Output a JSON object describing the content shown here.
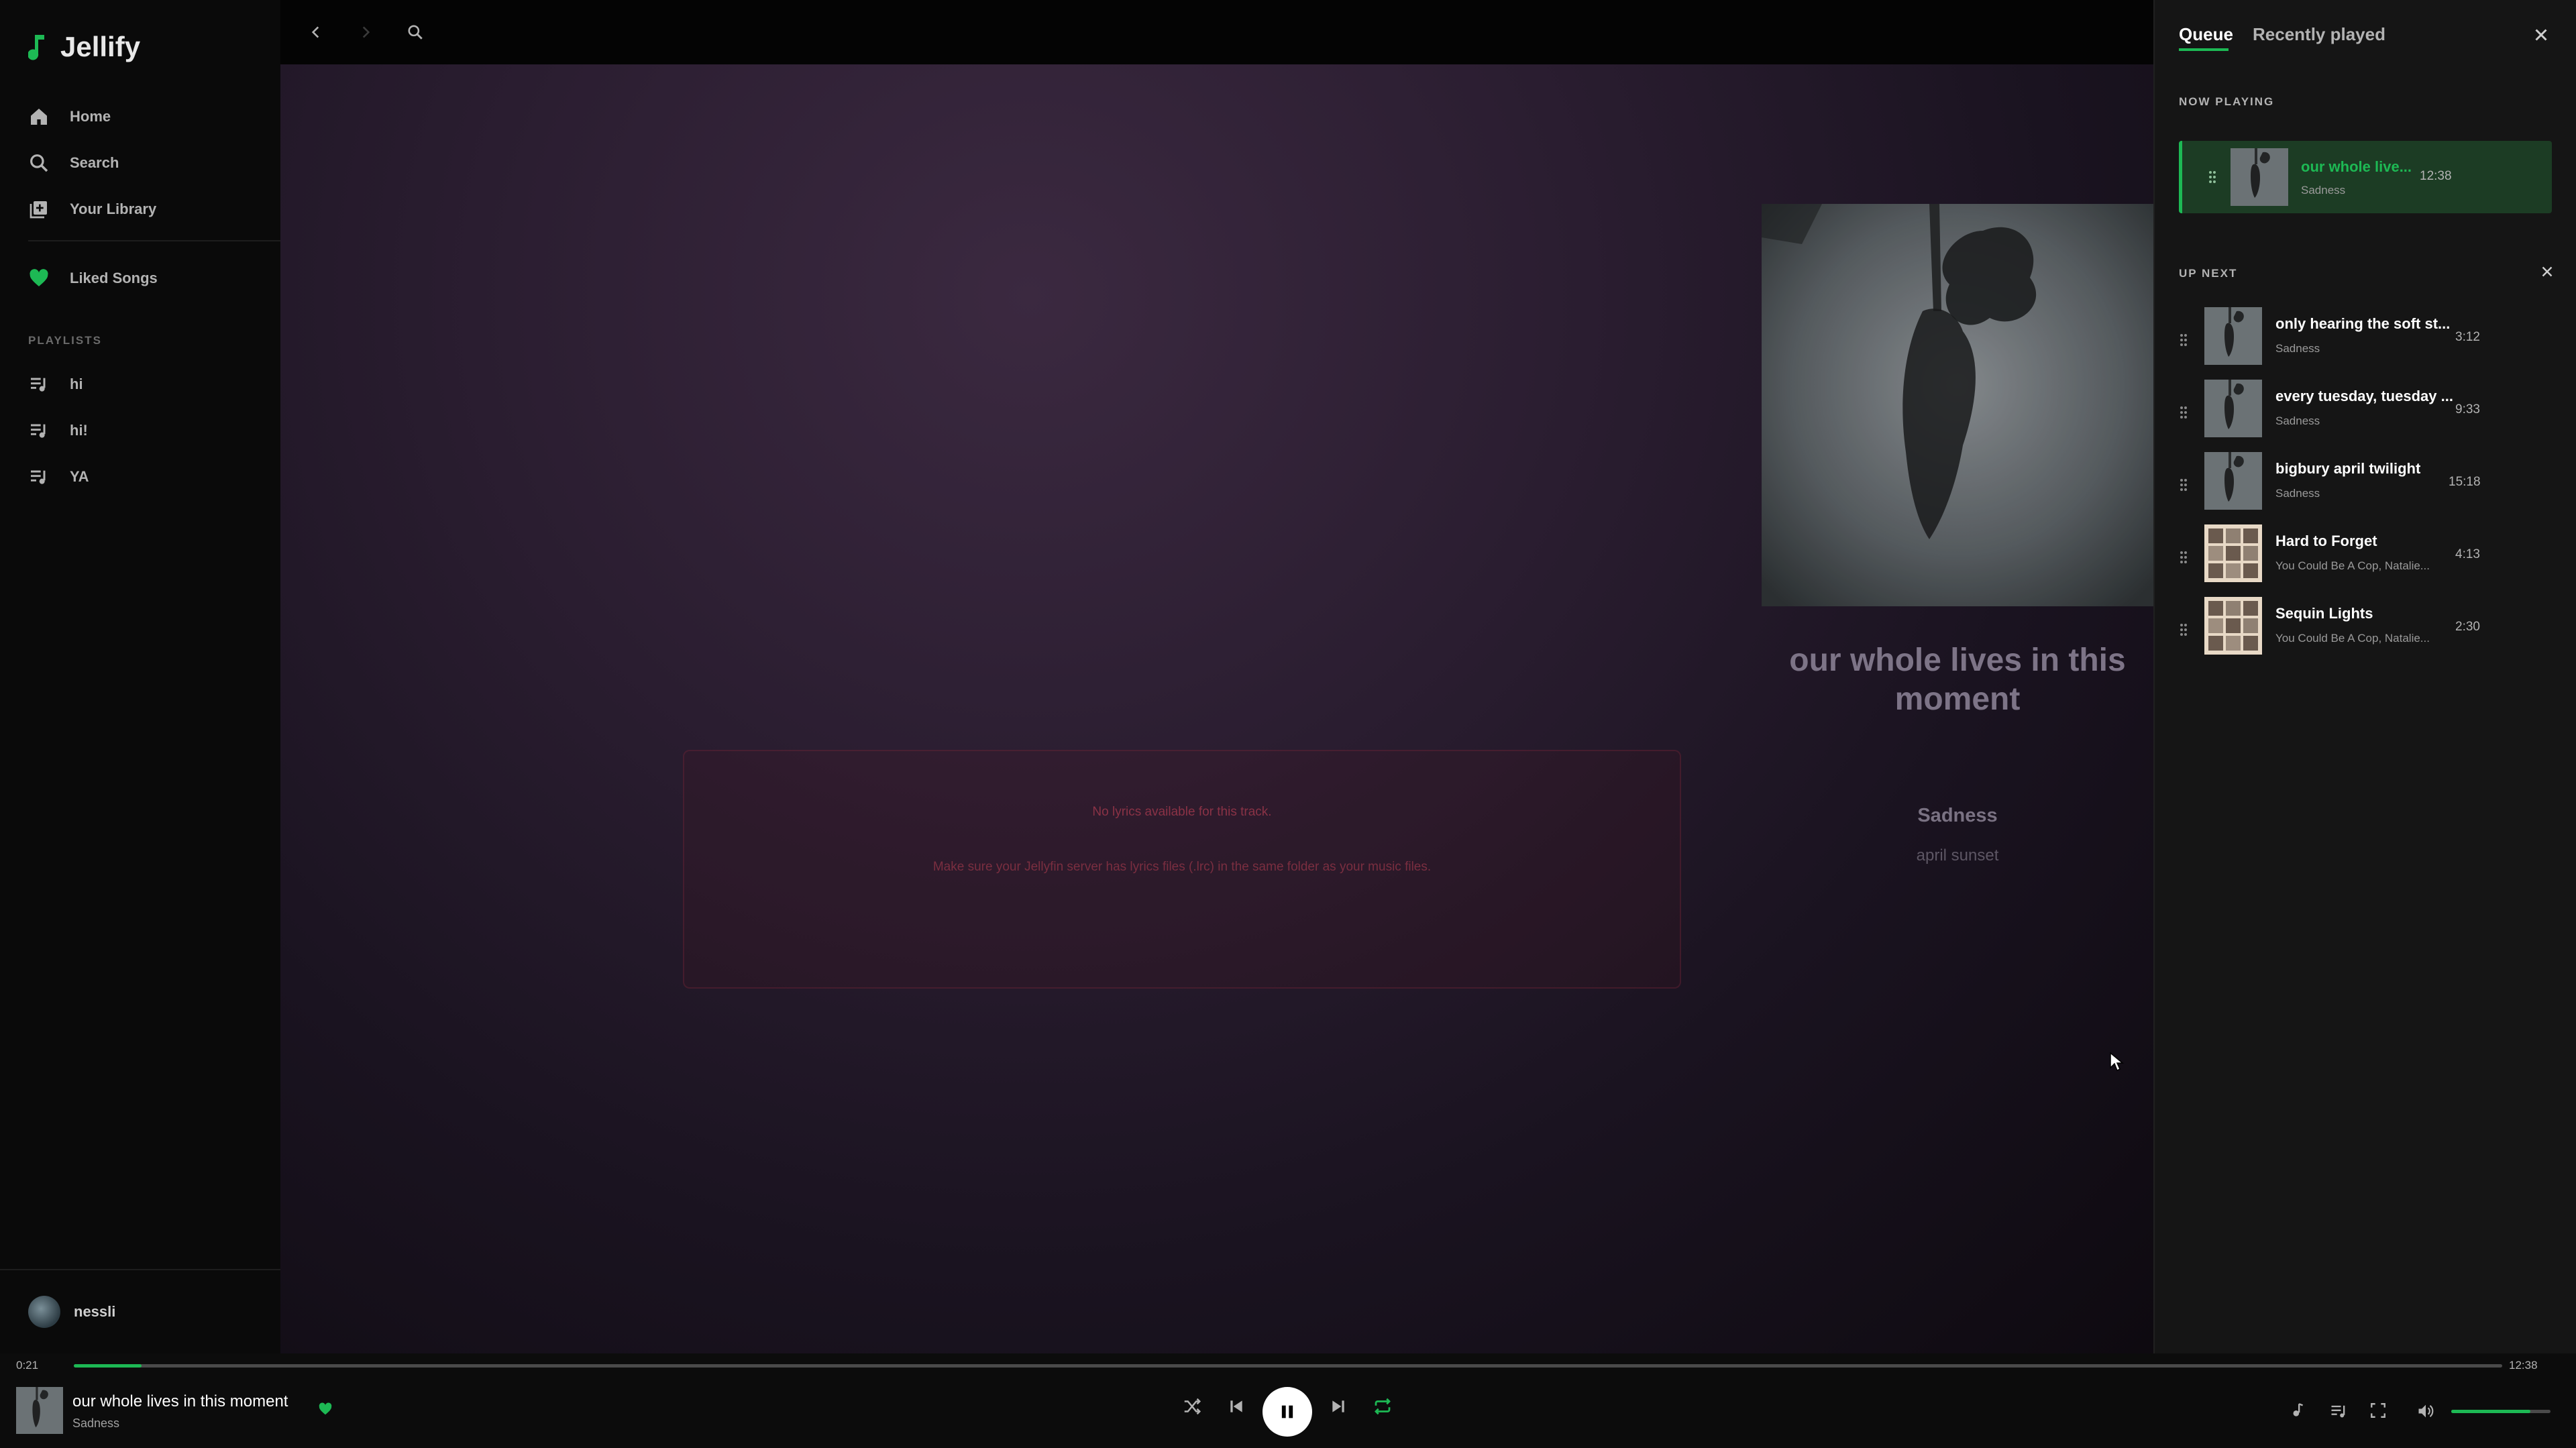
{
  "app": {
    "name": "Jellify"
  },
  "sidebar": {
    "nav": [
      {
        "label": "Home",
        "icon": "home-icon"
      },
      {
        "label": "Search",
        "icon": "search-icon"
      },
      {
        "label": "Your Library",
        "icon": "library-icon"
      }
    ],
    "liked": {
      "label": "Liked Songs",
      "icon": "heart-icon",
      "color": "#1db954"
    },
    "playlists_label": "PLAYLISTS",
    "playlists": [
      {
        "label": "hi"
      },
      {
        "label": "hi!"
      },
      {
        "label": "YA"
      }
    ],
    "user": {
      "name": "nessli"
    }
  },
  "main": {
    "lyrics": {
      "message": "No lyrics available for this track.",
      "hint": "Make sure your Jellyfin server has lyrics files (.lrc) in the same folder as your music files."
    },
    "track": {
      "title": "our whole lives in this moment",
      "artist": "Sadness",
      "album": "april sunset"
    }
  },
  "queue": {
    "tabs": {
      "queue": "Queue",
      "recent": "Recently played"
    },
    "now_playing_label": "NOW PLAYING",
    "now_playing": {
      "title": "our whole live...",
      "artist": "Sadness",
      "duration": "12:38"
    },
    "up_next_label": "UP NEXT",
    "items": [
      {
        "title": "only hearing the soft st...",
        "artist": "Sadness",
        "duration": "3:12",
        "art": "dark"
      },
      {
        "title": "every tuesday, tuesday ...",
        "artist": "Sadness",
        "duration": "9:33",
        "art": "dark"
      },
      {
        "title": "bigbury april twilight",
        "artist": "Sadness",
        "duration": "15:18",
        "art": "dark"
      },
      {
        "title": "Hard to Forget",
        "artist": "You Could Be A Cop, Natalie...",
        "duration": "4:13",
        "art": "light"
      },
      {
        "title": "Sequin Lights",
        "artist": "You Could Be A Cop, Natalie...",
        "duration": "2:30",
        "art": "light"
      }
    ]
  },
  "player": {
    "elapsed": "0:21",
    "total": "12:38",
    "progress": 0.028,
    "title": "our whole lives in this moment",
    "artist": "Sadness",
    "volume": 0.8,
    "accent": "#1db954"
  }
}
